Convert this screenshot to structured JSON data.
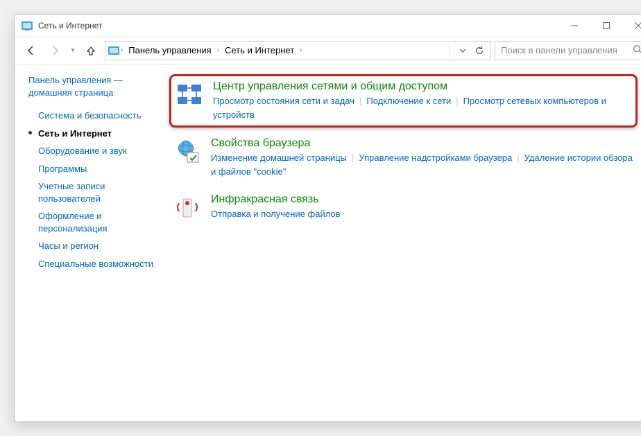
{
  "window": {
    "title": "Сеть и Интернет"
  },
  "nav": {
    "breadcrumb": [
      "Панель управления",
      "Сеть и Интернет"
    ],
    "search_placeholder": "Поиск в панели управления"
  },
  "sidebar": {
    "home": "Панель управления — домашняя страница",
    "items": [
      {
        "label": "Система и безопасность",
        "active": false
      },
      {
        "label": "Сеть и Интернет",
        "active": true
      },
      {
        "label": "Оборудование и звук",
        "active": false
      },
      {
        "label": "Программы",
        "active": false
      },
      {
        "label": "Учетные записи пользователей",
        "active": false
      },
      {
        "label": "Оформление и персонализация",
        "active": false
      },
      {
        "label": "Часы и регион",
        "active": false
      },
      {
        "label": "Специальные возможности",
        "active": false
      }
    ]
  },
  "categories": [
    {
      "title": "Центр управления сетями и общим доступом",
      "links": [
        "Просмотр состояния сети и задач",
        "Подключение к сети",
        "Просмотр сетевых компьютеров и устройств"
      ],
      "highlight": true,
      "icon": "network-sharing-icon"
    },
    {
      "title": "Свойства браузера",
      "links": [
        "Изменение домашней страницы",
        "Управление надстройками браузера",
        "Удаление истории обзора и файлов \"cookie\""
      ],
      "highlight": false,
      "icon": "internet-options-icon"
    },
    {
      "title": "Инфракрасная связь",
      "links": [
        "Отправка и получение файлов"
      ],
      "highlight": false,
      "icon": "infrared-icon"
    }
  ]
}
